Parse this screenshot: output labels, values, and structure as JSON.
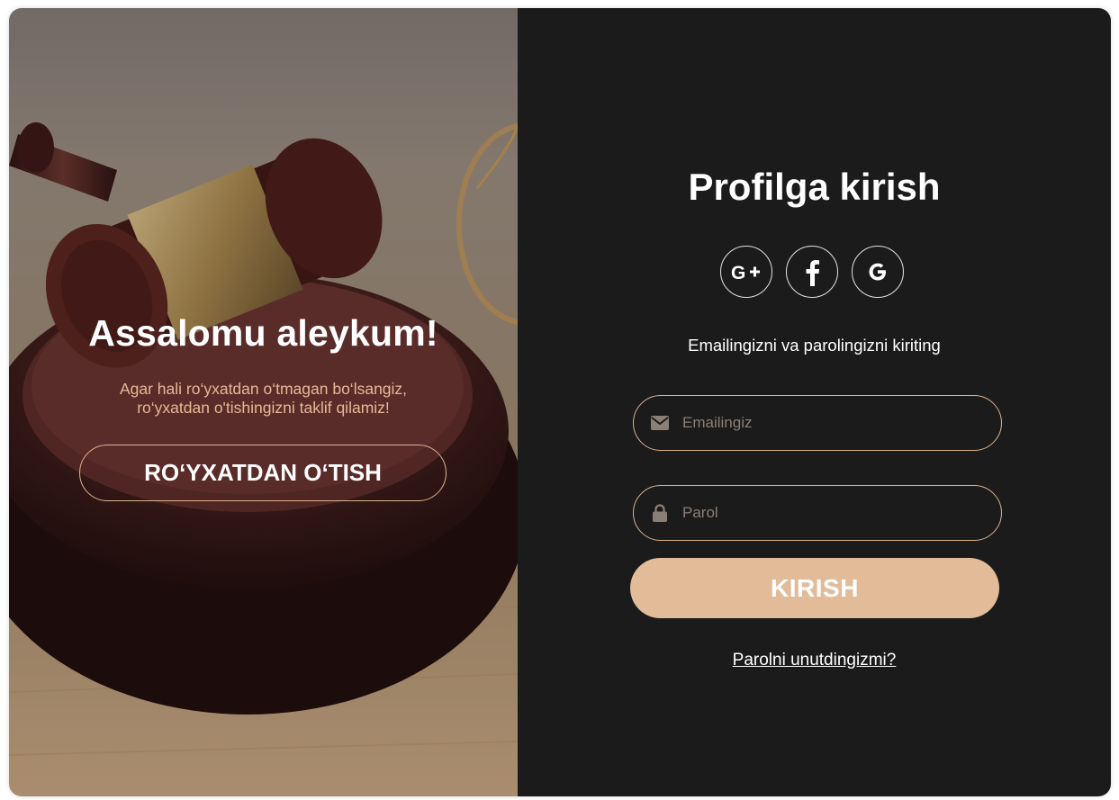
{
  "colors": {
    "accent": "#e2bc99",
    "panel_dark": "#1b1b1b",
    "invite_text": "#e3b995"
  },
  "left_panel": {
    "image": "judge-gavel-photo",
    "greeting": "Assalomu aleykum!",
    "invite_line1": "Agar hali ro‘yxatdan o‘tmagan bo‘lsangiz,",
    "invite_line2": "ro‘yxatdan o'tishingizni taklif qilamiz!",
    "signup_button": "RO‘YXATDAN O‘TISH"
  },
  "right_panel": {
    "title": "Profilga kirish",
    "social_buttons": [
      {
        "icon": "google-plus-icon",
        "label": "G+"
      },
      {
        "icon": "facebook-icon",
        "label": "f"
      },
      {
        "icon": "google-icon",
        "label": "G"
      }
    ],
    "hint": "Emailingizni va parolingizni kiriting",
    "email_field": {
      "icon": "mail-icon",
      "placeholder": "Emailingiz",
      "value": ""
    },
    "password_field": {
      "icon": "lock-icon",
      "placeholder": "Parol",
      "value": ""
    },
    "login_button": "KIRISH",
    "forgot_link": "Parolni unutdingizmi?"
  }
}
